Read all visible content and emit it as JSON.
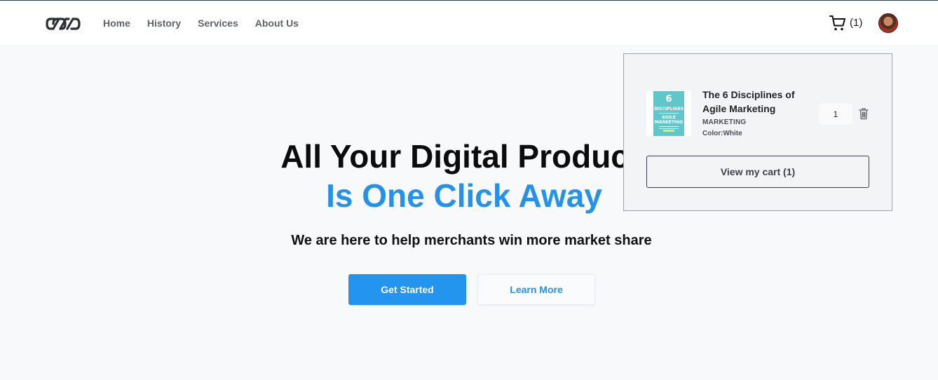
{
  "nav": {
    "logo_icon": "infinity-links-logo",
    "links": [
      "Home",
      "History",
      "Services",
      "About Us"
    ],
    "cart_icon": "cart-icon",
    "cart_count": "(1)",
    "avatar": "user-avatar"
  },
  "hero": {
    "title_line1": "All Your Digital Products",
    "title_line2": "Is One Click Away",
    "subtitle": "We are here to help merchants win more market share",
    "primary_button": "Get Started",
    "secondary_button": "Learn More",
    "accent_color": "#2491eb"
  },
  "cart_dropdown": {
    "items": [
      {
        "title": "The 6 Disciplines of Agile Marketing",
        "category": "MARKETING",
        "color": "Color:White",
        "quantity": "1",
        "cover": {
          "number": "6",
          "line1": "DISCIPLINES",
          "line2": "AGILE",
          "line3": "MARKETING"
        }
      }
    ],
    "view_cart_label": "View my cart (1)"
  }
}
